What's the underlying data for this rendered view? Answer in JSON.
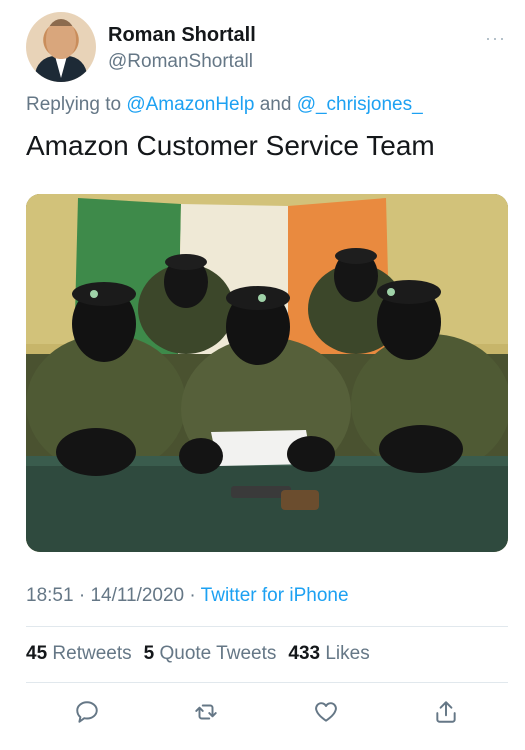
{
  "tweet": {
    "author_name": "Roman Shortall",
    "author_handle": "@RomanShortall",
    "more_glyph": "···",
    "reply_prefix": "Replying to",
    "reply_mention_1": "@AmazonHelp",
    "reply_and": "and",
    "reply_mention_2": "@_chrisjones_",
    "text": "Amazon Customer Service Team",
    "time": "18:51",
    "date": "14/11/2020",
    "source": "Twitter for iPhone",
    "retweets_count": "45",
    "retweets_label": "Retweets",
    "quote_count": "5",
    "quote_label": "Quote Tweets",
    "likes_count": "433",
    "likes_label": "Likes"
  },
  "icons": {
    "reply": "reply-icon",
    "retweet": "retweet-icon",
    "like": "heart-icon",
    "share": "share-icon"
  },
  "colors": {
    "link": "#1da1f2",
    "secondary_text": "#657786"
  }
}
